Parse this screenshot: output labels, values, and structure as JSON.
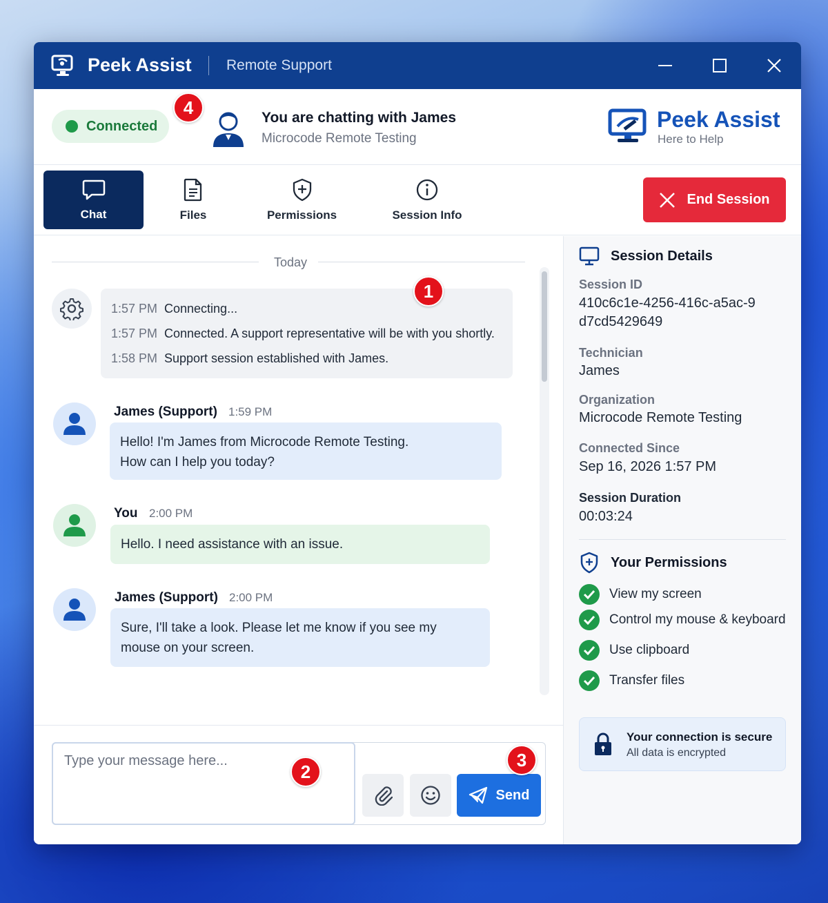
{
  "window": {
    "app_title": "Peek Assist",
    "subtitle": "Remote Support"
  },
  "header": {
    "status": "Connected",
    "chat_title": "You are chatting with James",
    "organization": "Microcode Remote Testing",
    "brand_title": "Peek Assist",
    "brand_tagline": "Here to Help"
  },
  "tabs": [
    {
      "label": "Chat",
      "icon": "chat-bubble-icon",
      "active": true
    },
    {
      "label": "Files",
      "icon": "file-icon",
      "active": false
    },
    {
      "label": "Permissions",
      "icon": "shield-icon",
      "active": false
    },
    {
      "label": "Session Info",
      "icon": "info-icon",
      "active": false
    }
  ],
  "end_session_label": "End Session",
  "chat": {
    "day_divider": "Today",
    "system_messages": [
      {
        "time": "1:57 PM",
        "text": "Connecting..."
      },
      {
        "time": "1:57 PM",
        "text": "Connected. A support representative will be with you shortly."
      },
      {
        "time": "1:58 PM",
        "text": "Support session established with James."
      }
    ],
    "messages": [
      {
        "sender": "James (Support)",
        "time": "1:59 PM",
        "line1": "Hello! I'm James from Microcode Remote Testing.",
        "line2": "How can I help you today?"
      },
      {
        "sender": "You",
        "time": "2:00 PM",
        "line1": "Hello. I need assistance with an issue."
      },
      {
        "sender": "James (Support)",
        "time": "2:00 PM",
        "line1": "Sure, I'll take a look. Please let me know if you see my",
        "line2": "mouse on your screen."
      }
    ]
  },
  "composer": {
    "placeholder": "Type your message here...",
    "send_label": "Send"
  },
  "session_details": {
    "title": "Session Details",
    "session_id_label": "Session ID",
    "session_id": "410c6c1e-4256-416c-a5ac-9d7cd5429649",
    "technician_label": "Technician",
    "technician": "James",
    "organization_label": "Organization",
    "organization": "Microcode Remote Testing",
    "connected_since_label": "Connected Since",
    "connected_since": "Sep 16, 2026 1:57 PM",
    "duration_label": "Session Duration",
    "duration": "00:03:24"
  },
  "permissions": {
    "title": "Your Permissions",
    "items": [
      "View my screen",
      "Control my mouse & keyboard",
      "Use clipboard",
      "Transfer files"
    ]
  },
  "security": {
    "title": "Your connection is secure",
    "subtitle": "All data is encrypted"
  },
  "callouts": [
    "1",
    "2",
    "3",
    "4"
  ],
  "colors": {
    "titlebar": "#0f3f8f",
    "accent": "#1d6fe0",
    "danger": "#e5293a",
    "success": "#1f9a4a",
    "active_tab": "#0b2a5e"
  }
}
